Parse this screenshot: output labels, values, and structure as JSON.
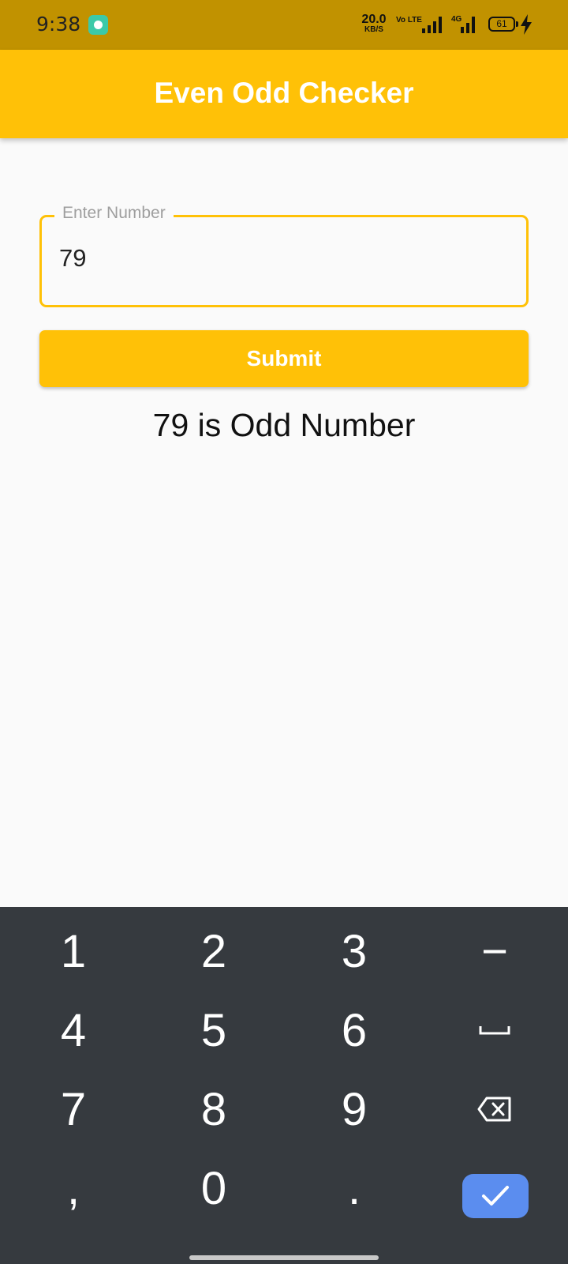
{
  "status_bar": {
    "time": "9:38",
    "net_speed_value": "20.0",
    "net_speed_unit": "KB/S",
    "volte_label": "Vo LTE",
    "network_type": "4G",
    "battery_level": "61",
    "icons": [
      "app-notification-icon",
      "signal-icon",
      "signal-icon",
      "battery-icon",
      "charging-bolt-icon"
    ]
  },
  "app_bar": {
    "title": "Even Odd Checker"
  },
  "form": {
    "input_label": "Enter Number",
    "input_value": "79",
    "submit_label": "Submit"
  },
  "result": {
    "text": "79 is Odd Number"
  },
  "keyboard": {
    "keys": [
      "1",
      "2",
      "3",
      "−",
      "4",
      "5",
      "6",
      "␣",
      "7",
      "8",
      "9",
      "backspace",
      ",",
      "0",
      ".",
      "done"
    ],
    "done_color": "#5b8def"
  },
  "colors": {
    "primary": "#ffc107",
    "status_bar": "#c19200",
    "keyboard_bg": "#363a3f",
    "background": "#fafafa"
  }
}
